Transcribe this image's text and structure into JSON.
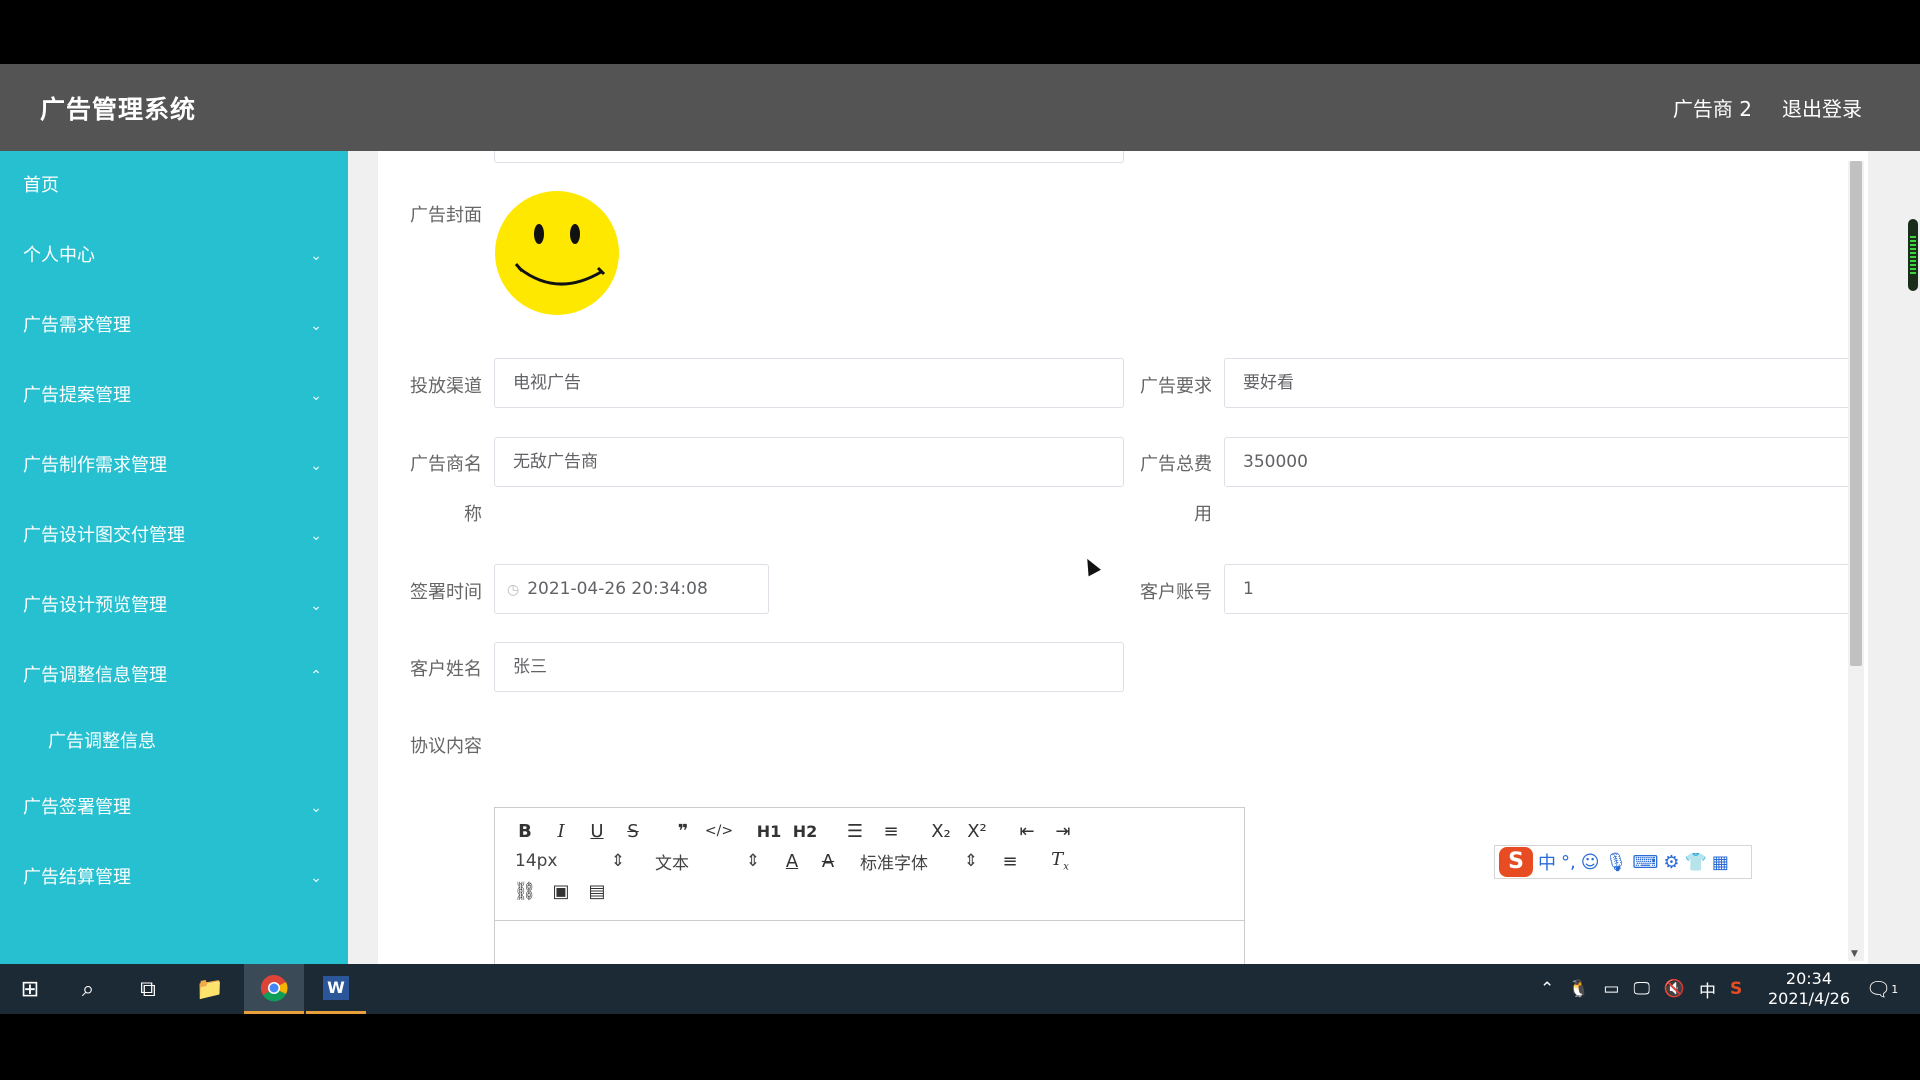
{
  "app": {
    "title": "广告管理系统",
    "user": "广告商 2",
    "logout": "退出登录"
  },
  "sidebar": {
    "items": [
      {
        "label": "首页",
        "expandable": false
      },
      {
        "label": "个人中心",
        "expandable": true,
        "chevron": "chevron-down"
      },
      {
        "label": "广告需求管理",
        "expandable": true,
        "chevron": "chevron-down"
      },
      {
        "label": "广告提案管理",
        "expandable": true,
        "chevron": "chevron-down"
      },
      {
        "label": "广告制作需求管理",
        "expandable": true,
        "chevron": "chevron-down"
      },
      {
        "label": "广告设计图交付管理",
        "expandable": true,
        "chevron": "chevron-down"
      },
      {
        "label": "广告设计预览管理",
        "expandable": true,
        "chevron": "chevron-down"
      },
      {
        "label": "广告调整信息管理",
        "expandable": true,
        "chevron": "chevron-up",
        "children": [
          "广告调整信息"
        ]
      },
      {
        "label": "广告签署管理",
        "expandable": true,
        "chevron": "chevron-down"
      },
      {
        "label": "广告结算管理",
        "expandable": true,
        "chevron": "chevron-down"
      }
    ]
  },
  "form": {
    "cover_label": "广告封面",
    "cover_image": "smiley-face",
    "channel": {
      "label": "投放渠道",
      "value": "电视广告"
    },
    "requirement": {
      "label": "广告要求",
      "value": "要好看"
    },
    "advertiser": {
      "label_line1": "广告商名",
      "label_line2": "称",
      "value": "无敌广告商"
    },
    "total_fee": {
      "label_line1": "广告总费",
      "label_line2": "用",
      "value": "350000"
    },
    "sign_time": {
      "label": "签署时间",
      "value": "2021-04-26 20:34:08",
      "icon": "clock-icon"
    },
    "client_account": {
      "label": "客户账号",
      "value": "1"
    },
    "client_name": {
      "label": "客户姓名",
      "value": "张三"
    },
    "agreement": {
      "label": "协议内容"
    }
  },
  "editor": {
    "font_size": "14px",
    "text_style": "文本",
    "font_family": "标准字体",
    "buttons_row1": [
      "B",
      "I",
      "U",
      "S",
      "❞",
      "</>",
      "H1",
      "H2",
      "ordered-list",
      "bullet-list",
      "X₂",
      "X²",
      "outdent",
      "indent"
    ],
    "buttons_row3": [
      "link",
      "image",
      "video"
    ]
  },
  "ime": {
    "logo": "S",
    "mode": "中",
    "punct": "°,"
  },
  "taskbar": {
    "time": "20:34",
    "date": "2021/4/26",
    "tray_lang": "中",
    "notification_count": "1"
  },
  "colors": {
    "sidebar": "#26c0d0",
    "topbar": "#545454",
    "taskbar": "#1c2a35"
  }
}
